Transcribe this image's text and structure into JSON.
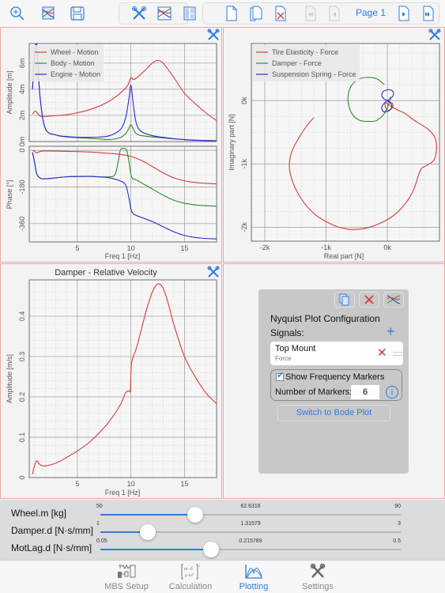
{
  "toolbar": {
    "left_icons": [
      "zoom-in-icon",
      "plot-layout-icon",
      "save-icon"
    ],
    "middle_icons": [
      "tools-icon",
      "signals-icon",
      "layout-icon"
    ],
    "page_icons": [
      "new-page-icon",
      "duplicate-page-icon",
      "delete-page-icon",
      "first-page-icon",
      "previous-page-icon",
      "next-page-icon",
      "last-page-icon"
    ],
    "page_label": "Page 1"
  },
  "colors": {
    "accent": "#2f7be0",
    "red": "#d83a3a",
    "green": "#2e8b2e",
    "blue": "#2a2ad0",
    "panel_border": "#f1a8a8"
  },
  "chart_data": [
    {
      "type": "line",
      "name": "bode-amplitude",
      "title": "",
      "xlabel": "",
      "ylabel": "Amplitude [m]",
      "xlim": [
        0.5,
        18
      ],
      "ylim": [
        0,
        7.5
      ],
      "x_ticks": [
        5,
        10,
        15
      ],
      "y_ticks": [
        0,
        2,
        4,
        6
      ],
      "y_tick_labels": [
        "0m",
        "2m",
        "4m",
        "6m"
      ],
      "legend": [
        "Wheel - Motion",
        "Body - Motion",
        "Engine - Motion"
      ],
      "legend_position": "top-left",
      "grid": true,
      "series": [
        {
          "name": "Wheel - Motion",
          "color": "#d83a3a",
          "x": [
            0.8,
            1.0,
            1.2,
            1.5,
            2,
            3,
            4,
            5,
            6,
            7,
            8,
            9,
            9.7,
            10,
            10.3,
            11,
            12,
            12.5,
            13,
            14,
            15,
            16,
            17,
            18
          ],
          "y": [
            2.1,
            2.3,
            2.25,
            1.95,
            1.92,
            1.98,
            2.05,
            2.2,
            2.4,
            2.7,
            3.1,
            3.7,
            4.3,
            4.9,
            4.75,
            5.2,
            6.0,
            6.2,
            6.0,
            4.9,
            3.7,
            2.9,
            2.2,
            1.6
          ]
        },
        {
          "name": "Body - Motion",
          "color": "#2e8b2e",
          "x": [
            0.8,
            1.0,
            1.2,
            1.5,
            2,
            3,
            4,
            5,
            6,
            7,
            8,
            9,
            9.5,
            9.8,
            10,
            10.2,
            10.5,
            11,
            12,
            13,
            14,
            15,
            16,
            17,
            18
          ],
          "y": [
            4.0,
            6.5,
            7.4,
            3.5,
            1.0,
            0.5,
            0.35,
            0.3,
            0.25,
            0.2,
            0.15,
            0.3,
            0.6,
            1.0,
            1.3,
            1.0,
            0.6,
            0.45,
            0.35,
            0.28,
            0.2,
            0.15,
            0.1,
            0.08,
            0.06
          ]
        },
        {
          "name": "Engine - Motion",
          "color": "#2a2ad0",
          "x": [
            0.8,
            1.0,
            1.2,
            1.5,
            2,
            3,
            4,
            5,
            6,
            7,
            8,
            9,
            9.5,
            9.8,
            10,
            10.2,
            10.5,
            11,
            12,
            13,
            14,
            15,
            16,
            17,
            18
          ],
          "y": [
            4.0,
            6.5,
            7.4,
            3.5,
            1.0,
            0.5,
            0.38,
            0.33,
            0.32,
            0.34,
            0.45,
            0.9,
            1.8,
            3.2,
            4.3,
            3.0,
            1.4,
            0.75,
            0.45,
            0.32,
            0.22,
            0.15,
            0.1,
            0.08,
            0.06
          ]
        }
      ]
    },
    {
      "type": "line",
      "name": "bode-phase",
      "xlabel": "Freq 1 [Hz]",
      "ylabel": "Phase [°]",
      "xlim": [
        0.5,
        18
      ],
      "ylim": [
        -450,
        20
      ],
      "x_ticks": [
        5,
        10,
        15
      ],
      "y_ticks": [
        0,
        -180,
        -360
      ],
      "grid": true,
      "series": [
        {
          "name": "Wheel - Motion",
          "color": "#d83a3a",
          "x": [
            0.8,
            1.0,
            1.2,
            1.5,
            2,
            4,
            6,
            8,
            9,
            10,
            11,
            12,
            13,
            14,
            15,
            16,
            17,
            18
          ],
          "y": [
            0,
            -5,
            -12,
            -6,
            -3,
            -5,
            -8,
            -15,
            -20,
            -30,
            -50,
            -80,
            -110,
            -135,
            -150,
            -158,
            -162,
            -165
          ]
        },
        {
          "name": "Body - Motion",
          "color": "#2e8b2e",
          "x": [
            0.8,
            1.0,
            1.2,
            1.5,
            2,
            4,
            6,
            7,
            8,
            8.5,
            8.8,
            9,
            9.3,
            9.6,
            9.8,
            10,
            10.2,
            10.5,
            11,
            12,
            13,
            14,
            15,
            16,
            17,
            18
          ],
          "y": [
            -10,
            -60,
            -115,
            -135,
            -140,
            -130,
            -128,
            -130,
            -130,
            -120,
            -60,
            0,
            10,
            0,
            -50,
            -120,
            -140,
            -145,
            -160,
            -190,
            -220,
            -245,
            -260,
            -268,
            -272,
            -275
          ]
        },
        {
          "name": "Engine - Motion",
          "color": "#2a2ad0",
          "x": [
            0.8,
            1.0,
            1.2,
            1.5,
            2,
            4,
            6,
            7,
            8,
            9,
            9.5,
            9.8,
            10,
            10.2,
            10.5,
            11,
            12,
            13,
            14,
            15,
            16,
            17,
            18
          ],
          "y": [
            -10,
            -60,
            -115,
            -135,
            -140,
            -130,
            -128,
            -130,
            -135,
            -150,
            -170,
            -230,
            -290,
            -310,
            -320,
            -330,
            -350,
            -375,
            -400,
            -418,
            -428,
            -433,
            -435
          ]
        }
      ]
    },
    {
      "type": "line",
      "name": "nyquist-plot",
      "xlabel": "Real part [N]",
      "ylabel": "Imaginary part [N]",
      "xlim": [
        -2220,
        850
      ],
      "ylim": [
        -2220,
        900
      ],
      "x_ticks": [
        -2000,
        -1000,
        0
      ],
      "x_tick_labels": [
        "-2k",
        "-1k",
        "0k"
      ],
      "y_ticks": [
        0,
        -1000,
        -2000
      ],
      "y_tick_labels": [
        "0k",
        "-1k",
        "-2k"
      ],
      "legend": [
        "Tire Elasticity - Force",
        "Damper - Force",
        "Suspension Spring - Force"
      ],
      "legend_position": "top-left",
      "grid": true,
      "series": [
        {
          "name": "Tire Elasticity - Force",
          "color": "#d83a3a",
          "x": [
            -1200,
            -1300,
            -1420,
            -1520,
            -1580,
            -1600,
            -1590,
            -1540,
            -1450,
            -1330,
            -1180,
            -1020,
            -850,
            -650,
            -450,
            -260,
            -80,
            80,
            230,
            350,
            440,
            500,
            540,
            570,
            590,
            650,
            760,
            800,
            790,
            740,
            660,
            550,
            450,
            380,
            280,
            150,
            40,
            -20,
            -40,
            0,
            80,
            90,
            60,
            0
          ],
          "y": [
            -270,
            -380,
            -550,
            -720,
            -870,
            -1000,
            -1130,
            -1300,
            -1480,
            -1650,
            -1800,
            -1900,
            -1980,
            -2030,
            -2030,
            -1990,
            -1920,
            -1830,
            -1700,
            -1550,
            -1380,
            -1200,
            -1100,
            -1060,
            -1050,
            -1020,
            -940,
            -780,
            -630,
            -530,
            -450,
            -380,
            -320,
            -270,
            -200,
            -140,
            -80,
            -40,
            -70,
            -150,
            -120,
            -60,
            -30,
            -20
          ]
        },
        {
          "name": "Damper - Force",
          "color": "#2e8b2e",
          "x": [
            -50,
            -170,
            -330,
            -480,
            -590,
            -640,
            -630,
            -570,
            -460,
            -320,
            -180,
            -150,
            -120,
            -60,
            -10,
            20,
            40,
            50
          ],
          "y": [
            250,
            340,
            365,
            330,
            230,
            80,
            -80,
            -220,
            -310,
            -330,
            -320,
            -290,
            -280,
            -220,
            -130,
            -60,
            20,
            60
          ]
        },
        {
          "name": "Suspension Spring - Force",
          "color": "#2a2ad0",
          "x": [
            0,
            -70,
            -90,
            -60,
            -10,
            -50,
            -90,
            -80,
            -40,
            10,
            60,
            70,
            30,
            0,
            40,
            90,
            100,
            70,
            30,
            0
          ],
          "y": [
            170,
            140,
            80,
            30,
            0,
            -40,
            -100,
            -160,
            -180,
            -170,
            -130,
            -70,
            -20,
            0,
            20,
            70,
            120,
            160,
            170,
            170
          ]
        }
      ]
    },
    {
      "type": "line",
      "name": "damper-relative-velocity",
      "title": "Damper - Relative Velocity",
      "xlabel": "Freq 1 [Hz]",
      "ylabel": "Amplitude [m/s]",
      "xlim": [
        0.5,
        18
      ],
      "ylim": [
        0,
        0.49
      ],
      "x_ticks": [
        5,
        10,
        15
      ],
      "y_ticks": [
        0,
        0.1,
        0.2,
        0.3,
        0.4
      ],
      "grid": true,
      "series": [
        {
          "name": "Damper - Relative Velocity",
          "color": "#d83a3a",
          "x": [
            0.8,
            1.0,
            1.2,
            1.5,
            2,
            3,
            4,
            5,
            6,
            7,
            8,
            9,
            9.5,
            9.8,
            9.95,
            10,
            10.1,
            10.5,
            11,
            11.5,
            12,
            12.5,
            13,
            13.5,
            14,
            15,
            16,
            17,
            18
          ],
          "y": [
            0.008,
            0.03,
            0.042,
            0.032,
            0.029,
            0.036,
            0.05,
            0.066,
            0.085,
            0.11,
            0.14,
            0.18,
            0.21,
            0.215,
            0.215,
            0.26,
            0.29,
            0.32,
            0.37,
            0.42,
            0.46,
            0.48,
            0.47,
            0.43,
            0.38,
            0.3,
            0.25,
            0.21,
            0.183
          ]
        }
      ]
    }
  ],
  "config_panel": {
    "title": "Nyquist Plot Configuration",
    "signals_label": "Signals:",
    "signal": {
      "name": "Top Mount",
      "type": "Force"
    },
    "show_markers_label": "Show Frequency Markers",
    "show_markers_checked": true,
    "num_markers_label": "Number of Markers:",
    "num_markers_value": "6",
    "switch_button": "Switch to Bode Plot"
  },
  "sliders": [
    {
      "label": "Wheel.m [kg]",
      "min": "50",
      "value": "62.6316",
      "max": "90",
      "fraction": 0.316
    },
    {
      "label": "Damper.d [N·s/mm]",
      "min": "1",
      "value": "1.31579",
      "max": "3",
      "fraction": 0.158
    },
    {
      "label": "MotLag.d [N·s/mm]",
      "min": "0.05",
      "value": "0.215789",
      "max": "0.5",
      "fraction": 0.368
    }
  ],
  "tabs": [
    {
      "label": "MBS Setup",
      "icon": "mbs-setup-icon",
      "active": false
    },
    {
      "label": "Calculation",
      "icon": "calculation-icon",
      "active": false
    },
    {
      "label": "Plotting",
      "icon": "plotting-icon",
      "active": true
    },
    {
      "label": "Settings",
      "icon": "settings-icon",
      "active": false
    }
  ]
}
